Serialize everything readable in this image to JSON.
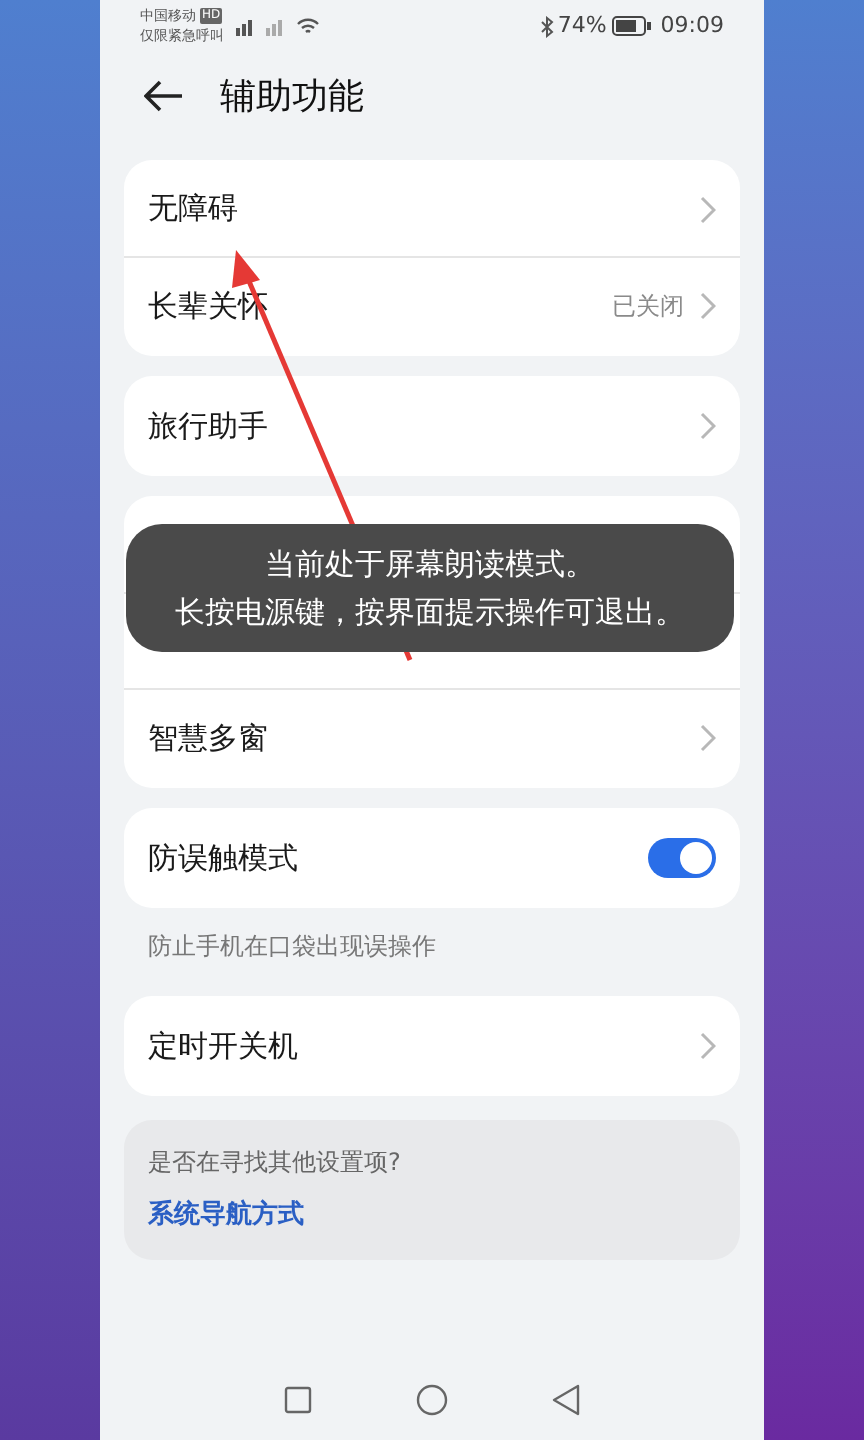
{
  "status_bar": {
    "carrier": "中国移动",
    "carrier_badge": "HD",
    "carrier_note": "仅限紧急呼叫",
    "battery": "74%",
    "time": "09:09"
  },
  "header": {
    "title": "辅助功能"
  },
  "groups": [
    {
      "items": [
        {
          "kind": "link",
          "label": "无障碍"
        },
        {
          "kind": "link",
          "label": "长辈关怀",
          "value": "已关闭"
        }
      ]
    },
    {
      "items": [
        {
          "kind": "link",
          "label": "旅行助手"
        }
      ]
    },
    {
      "items": [
        {
          "kind": "blank"
        },
        {
          "kind": "blank"
        },
        {
          "kind": "link",
          "label": "智慧多窗"
        }
      ]
    },
    {
      "items": [
        {
          "kind": "toggle",
          "label": "防误触模式",
          "on": true
        }
      ],
      "note": "防止手机在口袋出现误操作"
    },
    {
      "items": [
        {
          "kind": "link",
          "label": "定时开关机"
        }
      ]
    }
  ],
  "suggestion": {
    "question": "是否在寻找其他设置项?",
    "link": "系统导航方式"
  },
  "toast": {
    "lines": [
      "当前处于屏幕朗读模式。",
      "长按电源键，按界面提示操作可退出。"
    ]
  }
}
